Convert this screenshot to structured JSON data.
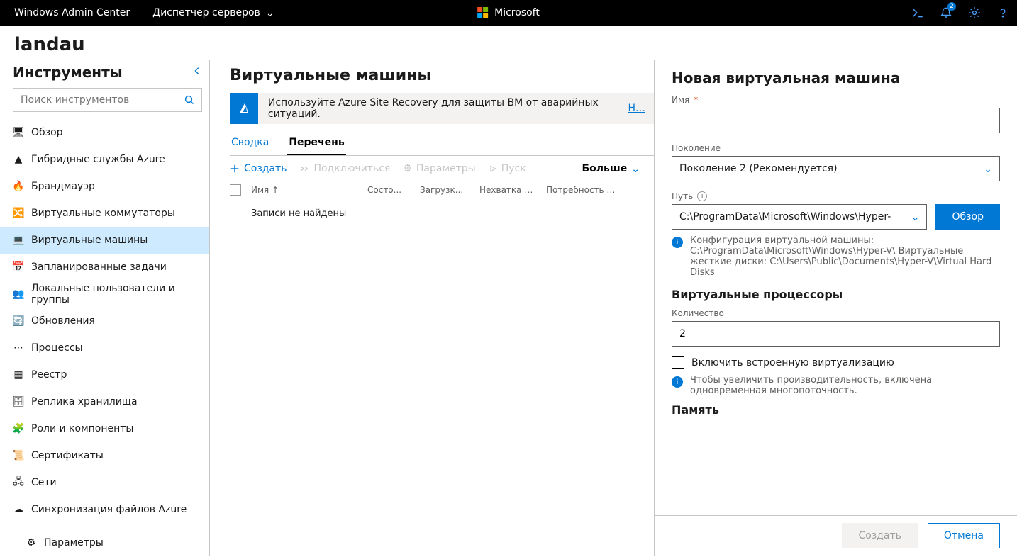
{
  "topbar": {
    "brand": "Windows Admin Center",
    "switcher": "Диспетчер серверов",
    "ms_label": "Microsoft",
    "notif_count": "2"
  },
  "host": "landau",
  "sidebar": {
    "title": "Инструменты",
    "search_placeholder": "Поиск инструментов",
    "items": [
      {
        "label": "Обзор",
        "icon": "🖥"
      },
      {
        "label": "Гибридные службы Azure",
        "icon": "▲"
      },
      {
        "label": "Брандмауэр",
        "icon": "🔥"
      },
      {
        "label": "Виртуальные коммутаторы",
        "icon": "🔀"
      },
      {
        "label": "Виртуальные машины",
        "icon": "💻"
      },
      {
        "label": "Запланированные задачи",
        "icon": "📅"
      },
      {
        "label": "Локальные пользователи и группы",
        "icon": "👥"
      },
      {
        "label": "Обновления",
        "icon": "🔄"
      },
      {
        "label": "Процессы",
        "icon": "⋯"
      },
      {
        "label": "Реестр",
        "icon": "▦"
      },
      {
        "label": "Реплика хранилища",
        "icon": "🗄"
      },
      {
        "label": "Роли и компоненты",
        "icon": "🧩"
      },
      {
        "label": "Сертификаты",
        "icon": "📜"
      },
      {
        "label": "Сети",
        "icon": "🖧"
      },
      {
        "label": "Синхронизация файлов Azure",
        "icon": "☁"
      }
    ],
    "settings_label": "Параметры"
  },
  "main": {
    "title": "Виртуальные машины",
    "banner_text": "Используйте Azure Site Recovery для защиты ВМ от аварийных ситуаций.",
    "banner_link": "Н…",
    "tabs": [
      "Сводка",
      "Перечень"
    ],
    "toolbar": {
      "create": "Создать",
      "connect": "Подключиться",
      "params": "Параметры",
      "start": "Пуск",
      "more": "Больше"
    },
    "columns": {
      "name": "Имя",
      "state": "Состо...",
      "load": "Загрузк...",
      "mem": "Нехватка па...",
      "need": "Потребность в па..."
    },
    "nodata": "Записи не найдены"
  },
  "panel": {
    "title": "Новая виртуальная машина",
    "name_label": "Имя",
    "gen_label": "Поколение",
    "gen_value": "Поколение 2 (Рекомендуется)",
    "path_label": "Путь",
    "path_value": "C:\\ProgramData\\Microsoft\\Windows\\Hyper-",
    "browse": "Обзор",
    "info_text": "Конфигурация виртуальной машины: C:\\ProgramData\\Microsoft\\Windows\\Hyper-V\\ Виртуальные жесткие диски: C:\\Users\\Public\\Documents\\Hyper-V\\Virtual Hard Disks",
    "vproc_head": "Виртуальные процессоры",
    "count_label": "Количество",
    "count_value": "2",
    "nested_virt": "Включить встроенную виртуализацию",
    "smt_info": "Чтобы увеличить производительность, включена одновременная многопоточность.",
    "mem_head": "Память",
    "create_btn": "Создать",
    "cancel_btn": "Отмена"
  }
}
